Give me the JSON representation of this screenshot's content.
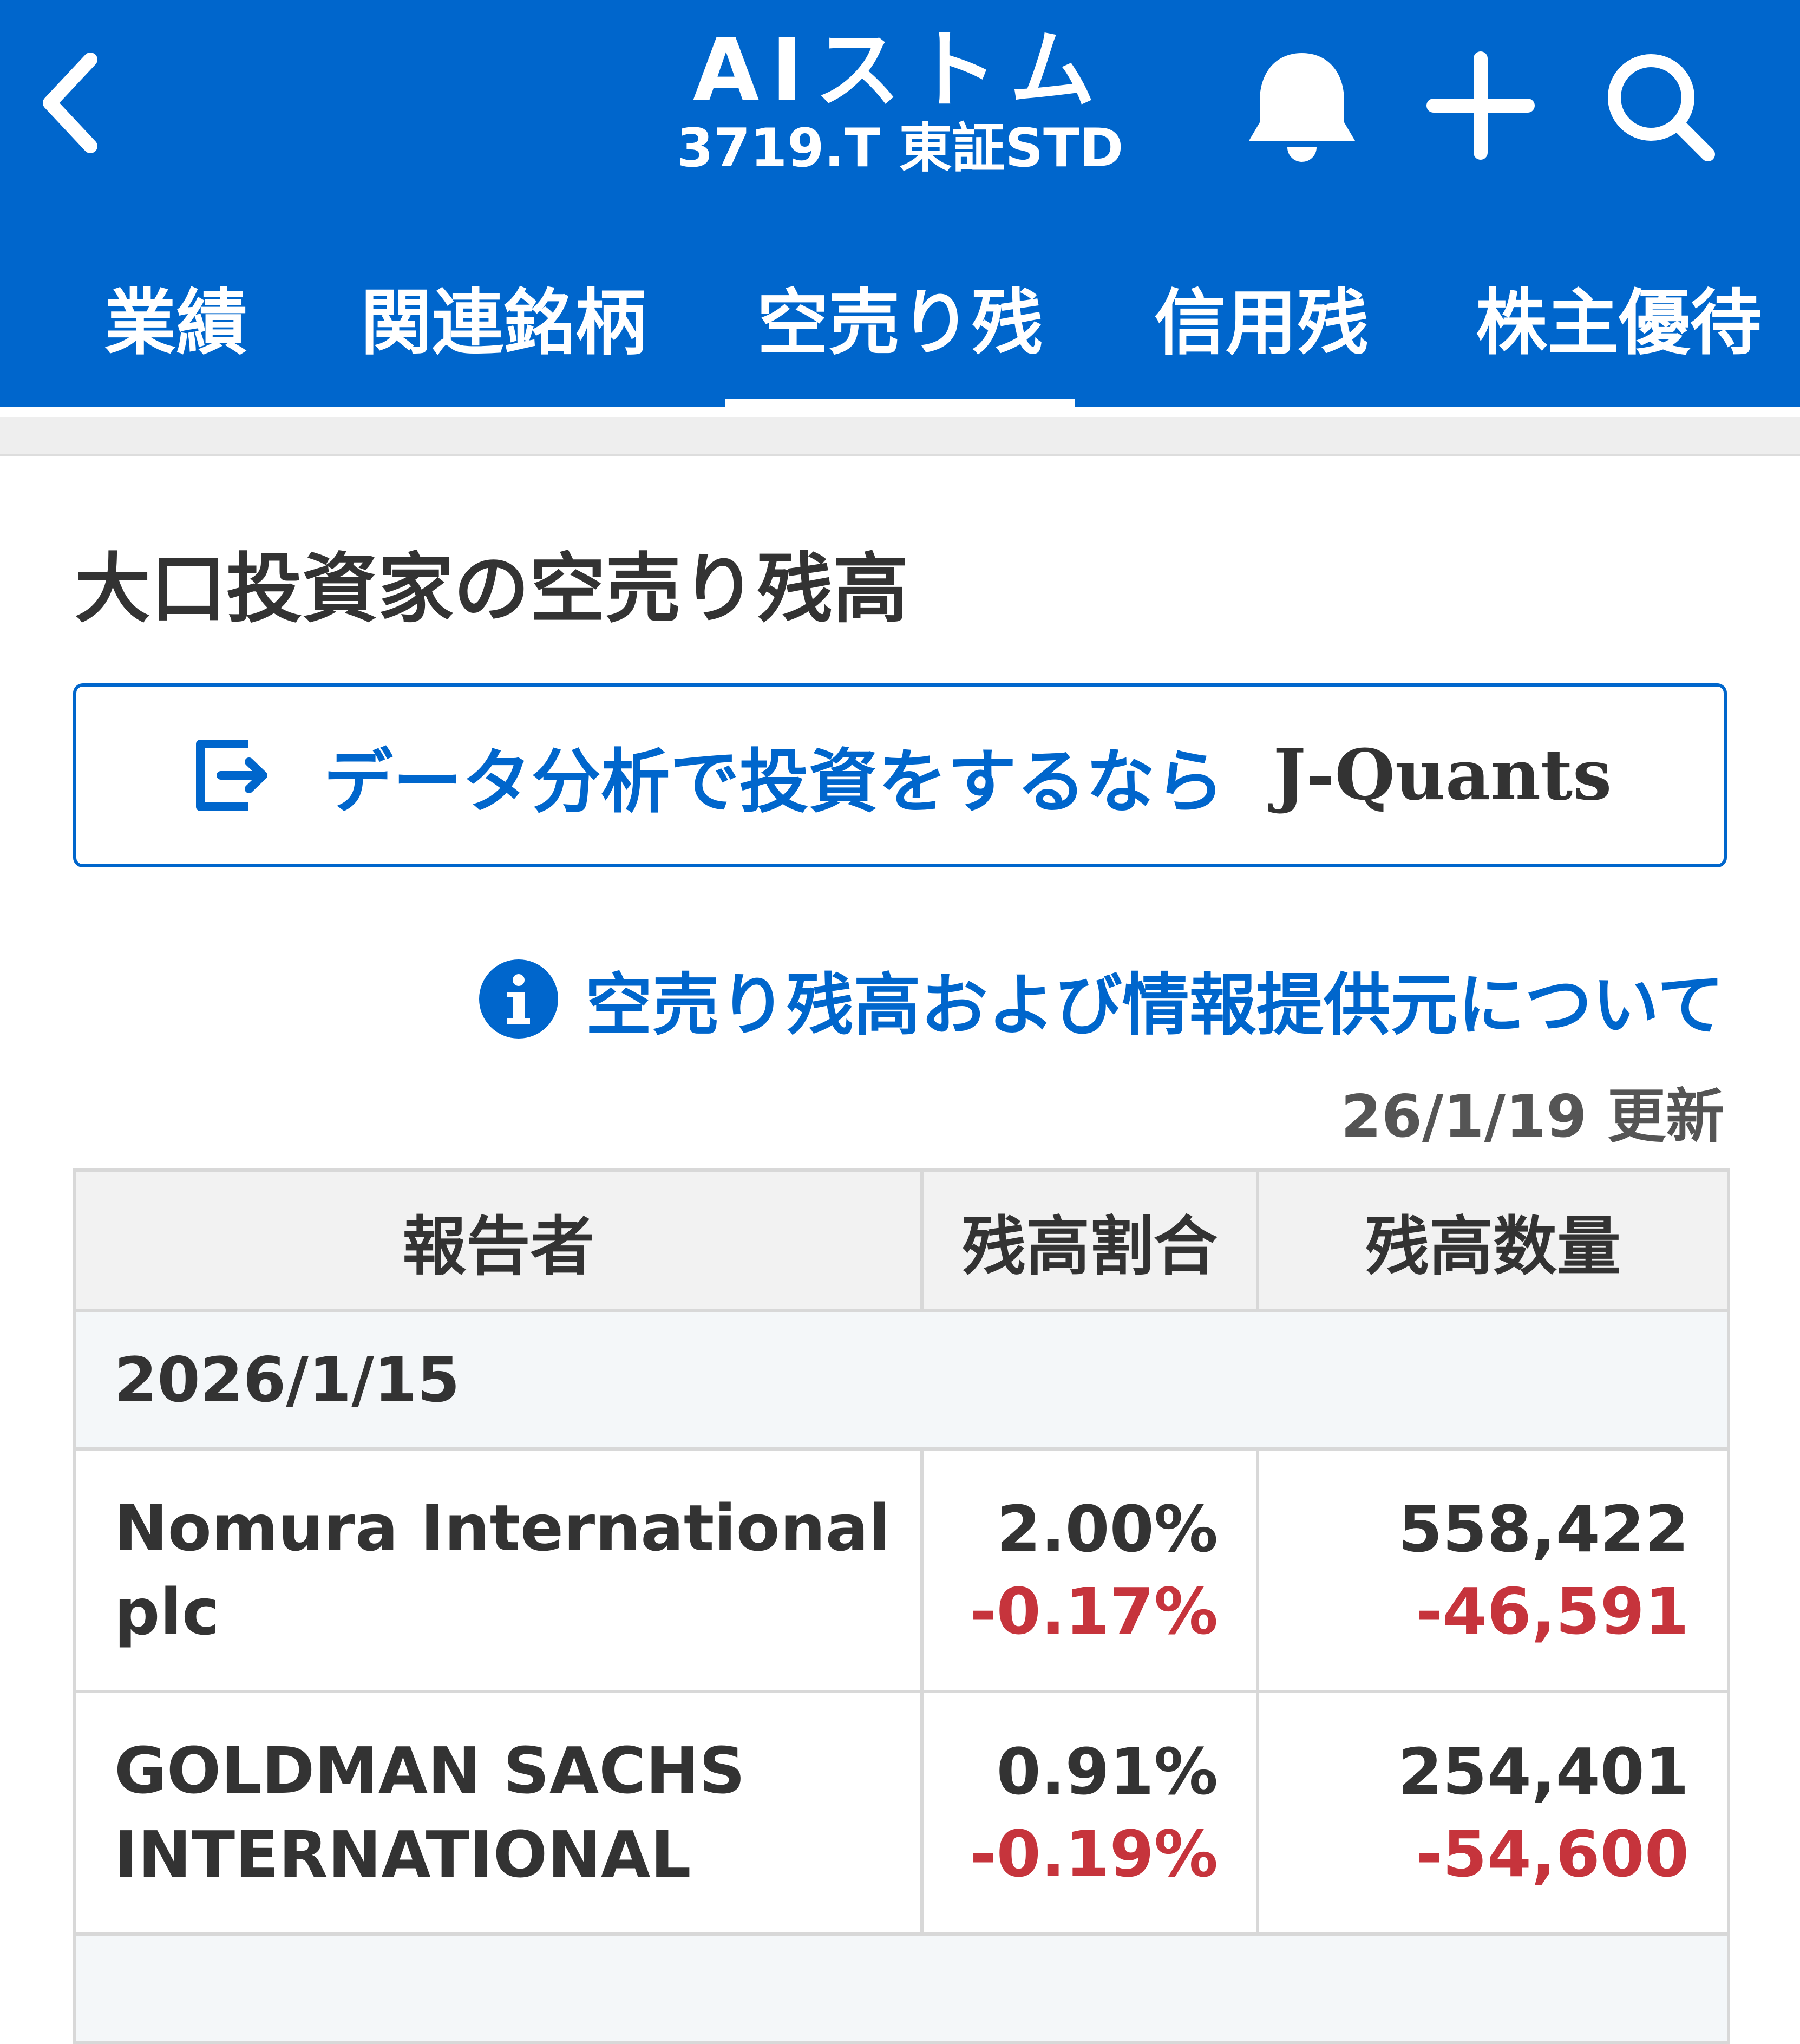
{
  "header": {
    "back_icon": "chevron-left-icon",
    "title": "AIストム",
    "subtitle": "3719.T 東証STD",
    "icons": [
      "bell-icon",
      "plus-icon",
      "search-icon"
    ]
  },
  "tabs": [
    {
      "label": "業績",
      "active": false
    },
    {
      "label": "関連銘柄",
      "active": false
    },
    {
      "label": "空売り残",
      "active": true
    },
    {
      "label": "信用残",
      "active": false
    },
    {
      "label": "株主優待",
      "active": false
    }
  ],
  "section": {
    "title": "大口投資家の空売り残高"
  },
  "jquants": {
    "icon": "external-link-icon",
    "text": "データ分析で投資をするなら",
    "logo_text": "J-Quants"
  },
  "info": {
    "icon": "info-icon",
    "text": "空売り残高および情報提供元について"
  },
  "updated": "26/1/19 更新",
  "table": {
    "headers": [
      "報告者",
      "残高割合",
      "残高数量"
    ],
    "date": "2026/1/15",
    "rows": [
      {
        "name_line1": "Nomura International",
        "name_line2": "plc",
        "ratio": "2.00%",
        "ratio_change": "-0.17%",
        "qty": "558,422",
        "qty_change": "-46,591"
      },
      {
        "name_line1": "GOLDMAN SACHS",
        "name_line2": "INTERNATIONAL",
        "ratio": "0.91%",
        "ratio_change": "-0.19%",
        "qty": "254,401",
        "qty_change": "-54,600"
      }
    ]
  },
  "colors": {
    "brand_blue": "#0066cc",
    "negative_red": "#c6343c",
    "text_dark": "#333333"
  }
}
